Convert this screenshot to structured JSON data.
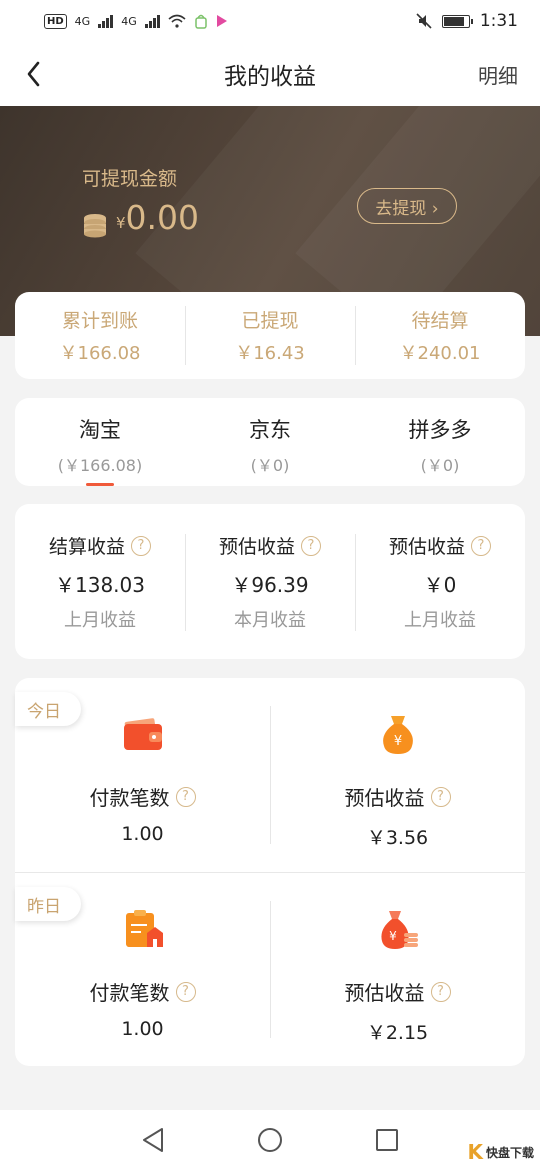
{
  "status_bar": {
    "left_badges": [
      "HD",
      "4G",
      "4G"
    ],
    "time": "1:31"
  },
  "header": {
    "title": "我的收益",
    "detail_label": "明细"
  },
  "hero": {
    "label": "可提现金额",
    "currency": "¥",
    "amount": "0.00",
    "withdraw_label": "去提现 ›"
  },
  "summary": [
    {
      "label": "累计到账",
      "value": "￥166.08"
    },
    {
      "label": "已提现",
      "value": "￥16.43"
    },
    {
      "label": "待结算",
      "value": "￥240.01"
    }
  ],
  "platforms": [
    {
      "name": "淘宝",
      "value": "(￥166.08)",
      "active": true
    },
    {
      "name": "京东",
      "value": "(￥0)",
      "active": false
    },
    {
      "name": "拼多多",
      "value": "(￥0)",
      "active": false
    }
  ],
  "estimates": [
    {
      "title": "结算收益",
      "value": "￥138.03",
      "sub": "上月收益"
    },
    {
      "title": "预估收益",
      "value": "￥96.39",
      "sub": "本月收益"
    },
    {
      "title": "预估收益",
      "value": "￥0",
      "sub": "上月收益"
    }
  ],
  "today": {
    "tag": "今日",
    "payments_title": "付款笔数",
    "payments_value": "1.00",
    "estimate_title": "预估收益",
    "estimate_value": "￥3.56"
  },
  "yesterday": {
    "tag": "昨日",
    "payments_title": "付款笔数",
    "payments_value": "1.00",
    "estimate_title": "预估收益",
    "estimate_value": "￥2.15"
  },
  "help_mark": "?",
  "watermark": {
    "mark": "K",
    "text": "快盘下载"
  },
  "colors": {
    "gold": "#caa877",
    "hero_bg": "#4a3d33",
    "accent": "#f05a3a",
    "icon_orange": "#f27a2c"
  }
}
